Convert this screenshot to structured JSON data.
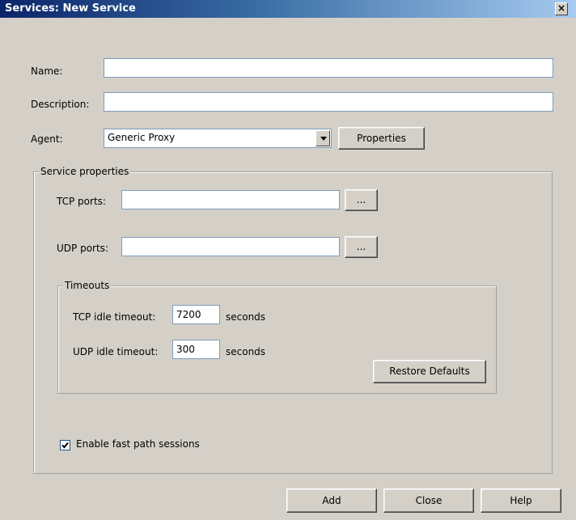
{
  "window": {
    "title": "Services: New Service",
    "close_glyph": "×"
  },
  "form": {
    "name_label": "Name:",
    "name_value": "",
    "description_label": "Description:",
    "description_value": "",
    "agent_label": "Agent:",
    "agent_value": "Generic Proxy",
    "properties_button": "Properties"
  },
  "service_properties": {
    "group_title": "Service properties",
    "tcp_ports_label": "TCP ports:",
    "tcp_ports_value": "",
    "udp_ports_label": "UDP ports:",
    "udp_ports_value": "",
    "browse_label": "..."
  },
  "timeouts": {
    "group_title": "Timeouts",
    "tcp_idle_label": "TCP idle timeout:",
    "tcp_idle_value": "7200",
    "udp_idle_label": "UDP idle timeout:",
    "udp_idle_value": "300",
    "unit_label": "seconds",
    "restore_button": "Restore Defaults"
  },
  "fast_path": {
    "label": "Enable fast path sessions",
    "checked": true
  },
  "footer": {
    "add_button": "Add",
    "close_button": "Close",
    "help_button": "Help"
  },
  "colors": {
    "title_start": "#0a246a",
    "title_end": "#a6caf0",
    "dialog_bg": "#d4d0c8"
  }
}
